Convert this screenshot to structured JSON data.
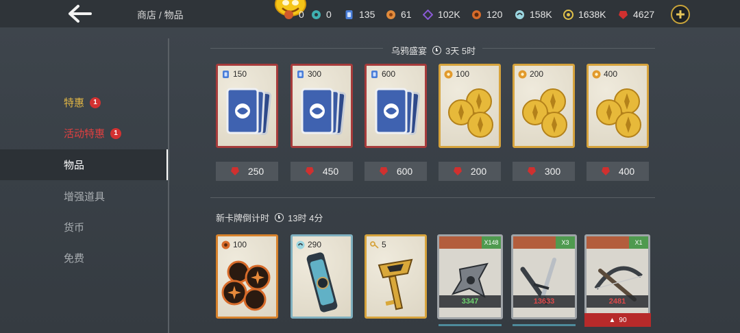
{
  "header": {
    "breadcrumb": "商店 / 物品",
    "resources": [
      {
        "name": "event-token",
        "value": "0",
        "color": "#d05a2b"
      },
      {
        "name": "teal-token",
        "value": "0",
        "color": "#3fb0b0"
      },
      {
        "name": "card-token",
        "value": "135",
        "color": "#4a7ed8"
      },
      {
        "name": "orange-coin",
        "value": "61",
        "color": "#e08a3b"
      },
      {
        "name": "purple-shard",
        "value": "102K",
        "color": "#8a5ad6"
      },
      {
        "name": "flower-coin",
        "value": "120",
        "color": "#d76b2a"
      },
      {
        "name": "swirl-token",
        "value": "158K",
        "color": "#9bd6e0"
      },
      {
        "name": "gold-coin",
        "value": "1638K",
        "color": "#e2c24a"
      },
      {
        "name": "ruby-gem",
        "value": "4627",
        "color": "#d0302f"
      }
    ]
  },
  "sidebar": {
    "items": [
      {
        "label": "特惠",
        "badge": "1",
        "color": "#e0b545"
      },
      {
        "label": "活动特惠",
        "badge": "1",
        "color": "#e04040"
      },
      {
        "label": "物品",
        "badge": "",
        "color": "#ffffff"
      },
      {
        "label": "增强道具",
        "badge": "",
        "color": "#a8adb1"
      },
      {
        "label": "货币",
        "badge": "",
        "color": "#a8adb1"
      },
      {
        "label": "免费",
        "badge": "",
        "color": "#a8adb1"
      }
    ]
  },
  "section1": {
    "title": "乌鸦盛宴",
    "timer": "3天 5时",
    "cards": [
      {
        "qty": "150",
        "kind": "card-pack",
        "price": "250"
      },
      {
        "qty": "300",
        "kind": "card-pack",
        "price": "450"
      },
      {
        "qty": "600",
        "kind": "card-pack",
        "price": "600"
      },
      {
        "qty": "100",
        "kind": "gold-coins",
        "price": "200"
      },
      {
        "qty": "200",
        "kind": "gold-coins",
        "price": "300"
      },
      {
        "qty": "400",
        "kind": "gold-coins",
        "price": "400"
      }
    ]
  },
  "section2": {
    "title": "新卡牌倒计时",
    "timer": "13时 4分",
    "cards": [
      {
        "qty": "100",
        "kind": "flower-coins"
      },
      {
        "qty": "290",
        "kind": "capsule"
      },
      {
        "qty": "5",
        "kind": "key"
      }
    ],
    "weapons": [
      {
        "tag": "X148",
        "stat": "3347",
        "stat_color": "#6fd46f",
        "kind": "shuriken"
      },
      {
        "tag": "X3",
        "stat": "13633",
        "stat_color": "#e04a4a",
        "kind": "daggers"
      },
      {
        "tag": "X1",
        "stat": "2481",
        "stat_color": "#e04a4a",
        "kind": "crossbow",
        "lock": "90"
      }
    ]
  }
}
